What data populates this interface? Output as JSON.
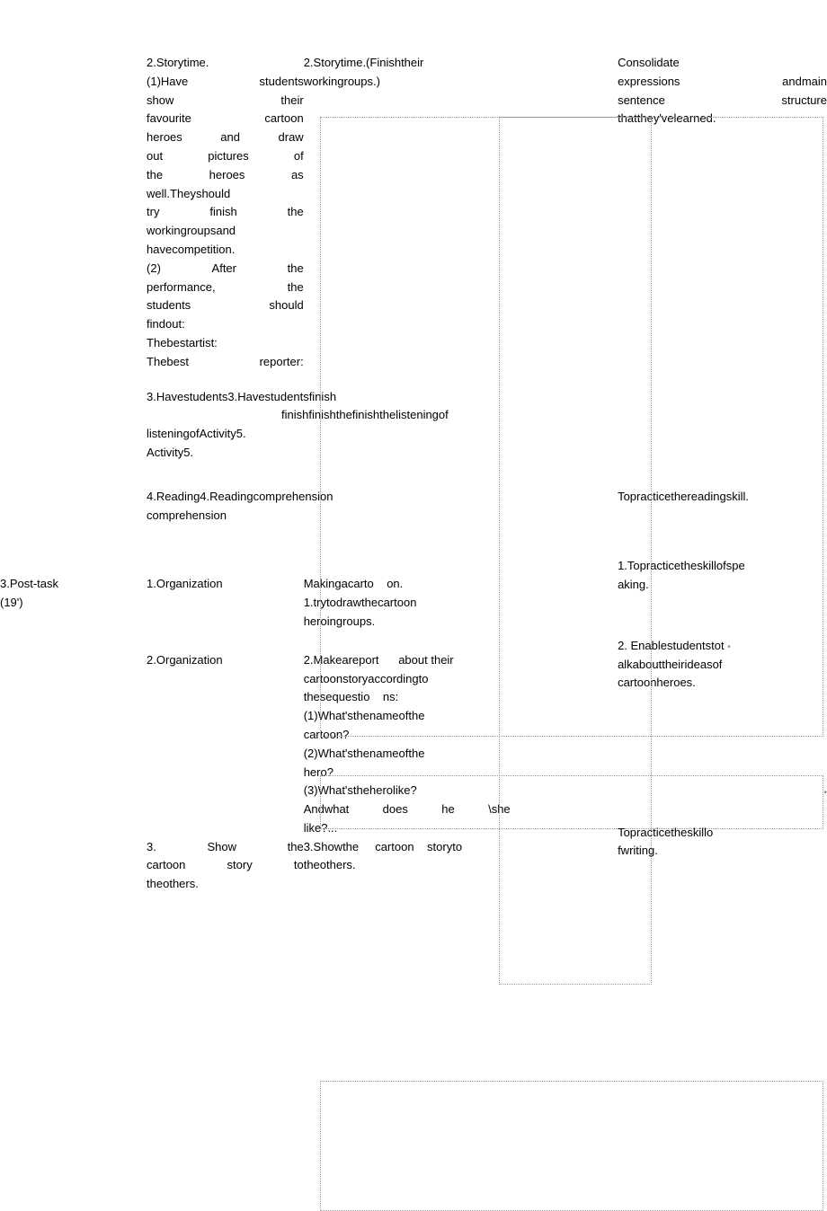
{
  "row1": {
    "col2": {
      "p1": "2.Storytime.",
      "p2a": "(1)Have",
      "p2b": "students",
      "p3a": "show",
      "p3b": "their",
      "p4a": "favourite",
      "p4b": "cartoon",
      "p5a": "heroes",
      "p5b": "and",
      "p5c": "draw",
      "p6a": "out",
      "p6b": "pictures",
      "p6c": "of",
      "p7a": "the",
      "p7b": "heroes",
      "p7c": "as",
      "p8": "well.Theyshould",
      "p9a": "try",
      "p9b": "finish",
      "p9c": "the",
      "p10": "workingroupsand",
      "p11": "havecompetition.",
      "p12a": "(2)",
      "p12b": "After",
      "p12c": "the",
      "p13a": "performance,",
      "p13b": "the",
      "p14a": "students",
      "p14b": "should",
      "p15": "findout:",
      "p16": "Thebestartist:",
      "p17a": "Thebest",
      "p17b": "reporter:"
    },
    "col3": {
      "p1": "2.Storytime.(Finishtheir",
      "p2": "workingroups.)"
    },
    "col4": {
      "p1": "Consolidate",
      "p2a": "expressions",
      "p2b": "andmain",
      "p3a": "sentence",
      "p3b": "structure",
      "p4": "thatthey'velearned."
    }
  },
  "row2": {
    "col2": "3.Havestudents3.Havestudentsfinish",
    "col3": "finishfinishthefinishthelisteningof",
    "col2b": "listeningofActivity5.",
    "col2c": "Activity5."
  },
  "row3": {
    "col2": "4.Reading4.Readingcomprehension",
    "col2b": "comprehension",
    "col4": "Topracticethereadingskill."
  },
  "row4": {
    "col1a": "3.Post-task",
    "col1b": "(19')",
    "col2": "1.Organization",
    "col3a": "Makingacarto",
    "col3b": "on.",
    "col3c": "1.trytodrawthecartoon",
    "col3d": "heroingroups.",
    "col4a": "1.Topracticetheskillofspe",
    "col4b": "aking."
  },
  "row5": {
    "col2": "2.Organization",
    "col3a": "2.Makeareport",
    "col3b": "about their",
    "col3c": "cartoonstoryaccordingto",
    "col3d": "thesequestio",
    "col3e": "ns:",
    "col3f": "(1)What'sthenameofthe",
    "col3g": "cartoon?",
    "col3h": "(2)What'sthenameofthe",
    "col3i": "hero?",
    "col3j": "(3)What'stheherolike?",
    "col3k": "Andwhat",
    "col3l": "does",
    "col3m": "he",
    "col3n": "\\she",
    "col3o": "like?...",
    "col4a": "2. Enablestudentstot",
    "col4b": "alkabouttheirideasof",
    "col4c": "cartoonheroes."
  },
  "row6": {
    "col2a": "3.",
    "col2b": "Show",
    "col2c": "the",
    "col2d": "cartoon",
    "col2e": "story",
    "col2f": "to",
    "col2g": "theothers.",
    "col3a": "3.Showthe",
    "col3b": "cartoon",
    "col3c": "storyto",
    "col3d": "theothers.",
    "col4a": "Topracticetheskillo",
    "col4b": "fwriting."
  }
}
